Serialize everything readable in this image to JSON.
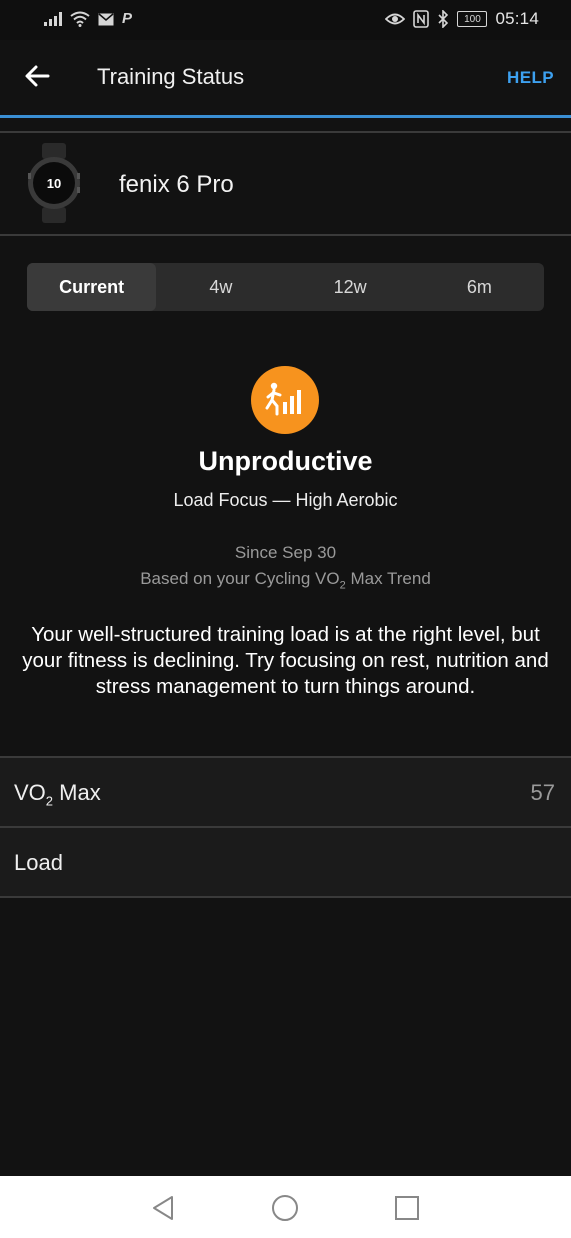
{
  "status_bar": {
    "time": "05:14",
    "battery": "100",
    "left_icons": [
      "signal-icon",
      "wifi-icon",
      "mail-icon",
      "parking-icon"
    ],
    "right_icons": [
      "eye-icon",
      "nfc-icon",
      "bluetooth-icon",
      "battery-icon"
    ]
  },
  "app_bar": {
    "title": "Training Status",
    "help_label": "HELP"
  },
  "device": {
    "name": "fenix 6 Pro",
    "watch_face_text": "10"
  },
  "tabs": [
    {
      "label": "Current",
      "active": true
    },
    {
      "label": "4w",
      "active": false
    },
    {
      "label": "12w",
      "active": false
    },
    {
      "label": "6m",
      "active": false
    }
  ],
  "status": {
    "title": "Unproductive",
    "load_focus": "Load Focus — High Aerobic",
    "since": "Since Sep 30",
    "based_on_prefix": "Based on your Cycling VO",
    "based_on_sub": "2",
    "based_on_suffix": " Max Trend",
    "description": "Your well-structured training load is at the right level, but your fitness is declining. Try focusing on rest, nutrition and stress management to turn things around.",
    "icon_color": "#f7931e"
  },
  "rows": {
    "vo2": {
      "label_prefix": "VO",
      "label_sub": "2",
      "label_suffix": " Max",
      "value": "57"
    },
    "load": {
      "label": "Load"
    }
  },
  "colors": {
    "accent": "#3da1f0",
    "background": "#121212"
  }
}
